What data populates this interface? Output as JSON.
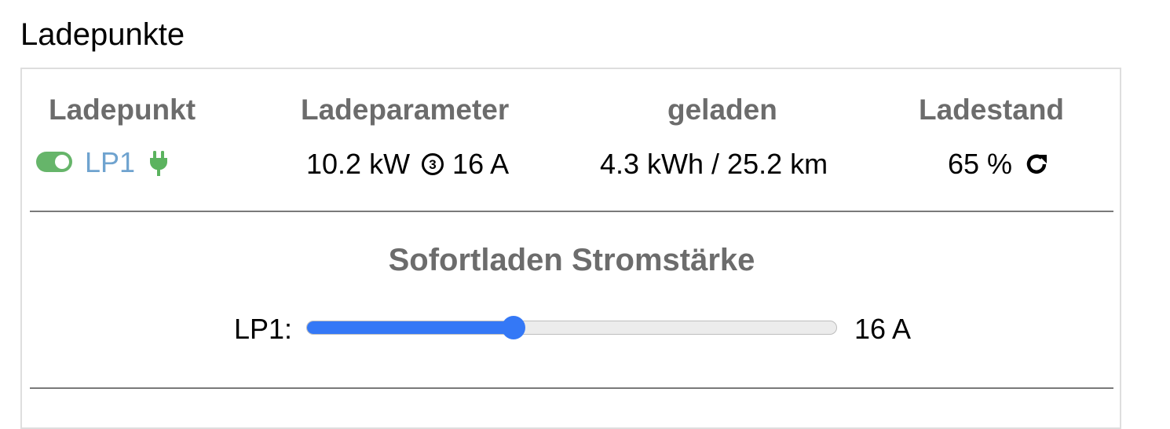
{
  "page": {
    "title": "Ladepunkte"
  },
  "table": {
    "headers": [
      "Ladepunkt",
      "Ladeparameter",
      "geladen",
      "Ladestand"
    ],
    "row": {
      "name": "LP1",
      "power": "10.2 kW",
      "phases": 3,
      "phase_icon": "phase-count-3-icon",
      "current": "16 A",
      "loaded": "4.3 kWh / 25.2 km",
      "soc": "65 %",
      "enabled": true,
      "plugged": true
    }
  },
  "instant_charge": {
    "title": "Sofortladen Stromstärke",
    "label": "LP1:",
    "value_text": "16 A",
    "value_fraction": 0.39
  },
  "colors": {
    "toggle_on": "#66b56a",
    "plug_icon": "#5bb35f",
    "link": "#6fa3cf",
    "slider_accent": "#3478f6",
    "header_gray": "#6c6c6c"
  },
  "icons": {
    "toggle": "toggle-switch-icon",
    "plug": "plug-icon",
    "refresh": "refresh-icon"
  }
}
